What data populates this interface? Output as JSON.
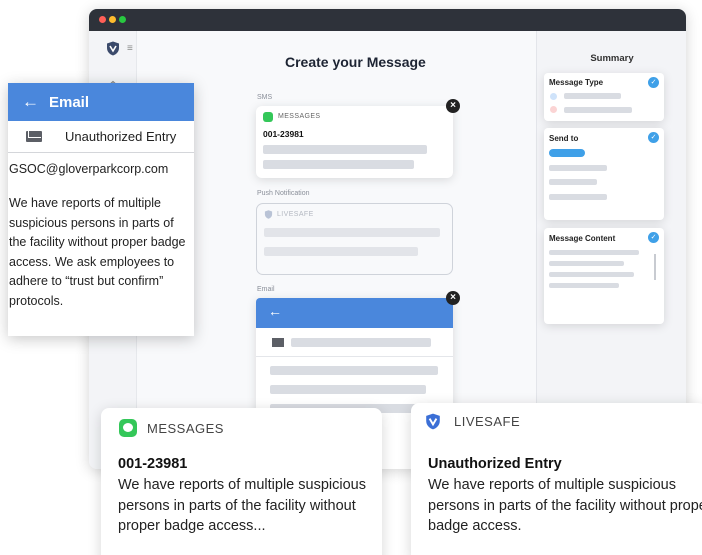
{
  "editor": {
    "title": "Create your Message",
    "sms_label": "SMS",
    "sms_app": "MESSAGES",
    "sms_number": "001-23981",
    "push_label": "Push Notification",
    "push_app": "LIVESAFE",
    "email_label": "Email"
  },
  "summary": {
    "title": "Summary",
    "message_type": "Message Type",
    "send_to": "Send to",
    "message_content": "Message Content"
  },
  "email_panel": {
    "title": "Email",
    "subject": "Unauthorized Entry",
    "from": "GSOC@gloverparkcorp.com",
    "body": "We have reports of multiple suspicious persons in parts of the facility without proper badge access. We ask employees to adhere to “trust but confirm” protocols."
  },
  "sms_notification": {
    "app": "MESSAGES",
    "heading": "001-23981",
    "body": "We have reports of multiple suspicious persons in parts of the facility without proper badge access..."
  },
  "push_notification": {
    "app": "LIVESAFE",
    "heading": "Unauthorized Entry",
    "body": "We have reports of multiple suspicious persons in parts of the facility without proper badge access."
  },
  "colors": {
    "accent": "#4a87dc",
    "messages_green": "#34c759",
    "livesafe_blue": "#3b6fd6"
  }
}
